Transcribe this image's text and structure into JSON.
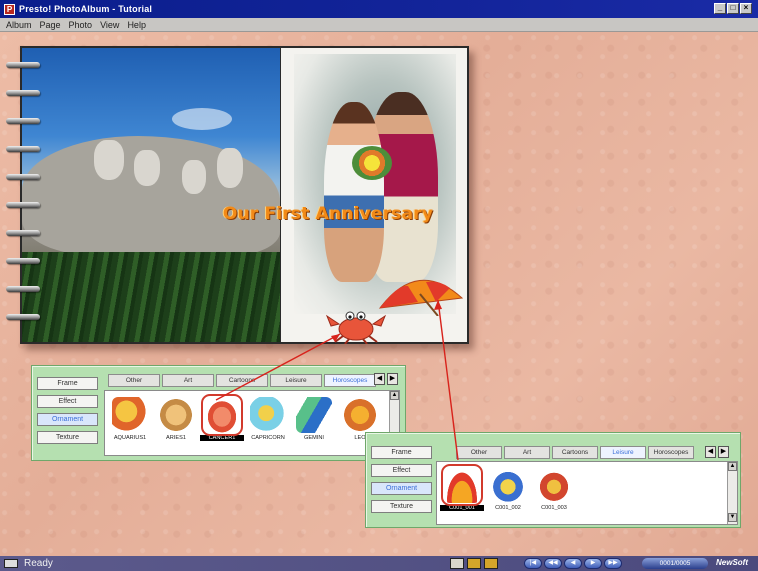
{
  "window": {
    "title": "Presto! PhotoAlbum - Tutorial",
    "controls": [
      "_",
      "□",
      "×"
    ]
  },
  "menu": [
    "Album",
    "Page",
    "Photo",
    "View",
    "Help"
  ],
  "album": {
    "caption": "Our First Anniversary",
    "ring_count": 10
  },
  "panel_left": {
    "side_buttons": [
      "Frame",
      "Effect",
      "Ornament",
      "Texture"
    ],
    "active_side": "Ornament",
    "tabs": [
      "Other",
      "Art",
      "Cartoons",
      "Leisure",
      "Horoscopes"
    ],
    "active_tab": "Horoscopes",
    "thumbs": [
      {
        "caption": "AQUARIUS1",
        "icon": "aquarius-icon",
        "colors": [
          "#f5c542",
          "#e0652a"
        ]
      },
      {
        "caption": "ARIES1",
        "icon": "aries-icon",
        "colors": [
          "#f0c27a",
          "#c58b45"
        ]
      },
      {
        "caption": "CANCER1",
        "icon": "cancer-crab-icon",
        "colors": [
          "#f28b6a",
          "#e04e34"
        ],
        "selected": true
      },
      {
        "caption": "CAPRICORN",
        "icon": "capricorn-icon",
        "colors": [
          "#7ad0e6",
          "#f2d04a"
        ]
      },
      {
        "caption": "GEMINI",
        "icon": "gemini-icon",
        "colors": [
          "#58c08a",
          "#2b6fc7"
        ]
      },
      {
        "caption": "LEO",
        "icon": "leo-icon",
        "colors": [
          "#f5b030",
          "#d9702a"
        ]
      }
    ]
  },
  "panel_right": {
    "side_buttons": [
      "Frame",
      "Effect",
      "Ornament",
      "Texture"
    ],
    "active_side": "Ornament",
    "tabs": [
      "Other",
      "Art",
      "Cartoons",
      "Leisure",
      "Horoscopes"
    ],
    "active_tab": "Leisure",
    "thumbs": [
      {
        "caption": "C001_001",
        "icon": "beach-umbrella-icon",
        "colors": [
          "#f5a623",
          "#e23a2a"
        ],
        "selected": true
      },
      {
        "caption": "C001_002",
        "icon": "fishing-cartoon-icon",
        "colors": [
          "#f2d34a",
          "#3a6fd0"
        ]
      },
      {
        "caption": "C001_003",
        "icon": "tennis-cartoon-icon",
        "colors": [
          "#f0c040",
          "#d2462e"
        ]
      }
    ]
  },
  "status": {
    "text": "Ready",
    "page": "0001/0005",
    "brand": "NewSoft",
    "nav": [
      "|◀",
      "◀◀",
      "◀",
      "▶",
      "▶▶"
    ]
  }
}
